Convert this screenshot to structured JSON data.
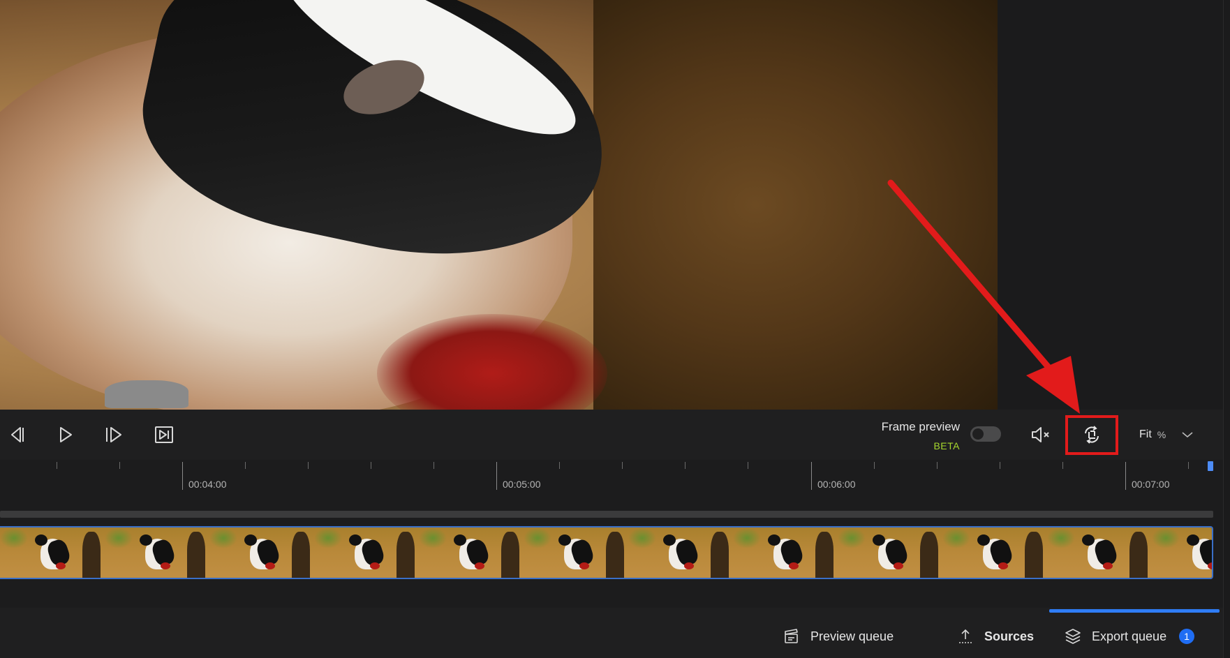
{
  "viewer": {
    "frame_description_icon": "video-frame"
  },
  "controls": {
    "frame_preview_label": "Frame preview",
    "frame_preview_badge": "BETA",
    "frame_preview_enabled": false,
    "zoom_value": "Fit",
    "zoom_unit": "%",
    "icons": {
      "prev_frame": "step-back-icon",
      "play": "play-icon",
      "next_frame": "step-forward-icon",
      "to_end": "skip-to-end-icon",
      "mute": "mute-icon",
      "crop": "crop-icon",
      "dropdown": "chevron-down-icon"
    }
  },
  "timeline": {
    "tick_labels": [
      "00:04:00",
      "00:05:00",
      "00:06:00",
      "00:07:00"
    ],
    "thumbnail_count": 12
  },
  "bottom_bar": {
    "tabs": [
      {
        "label": "Preview queue",
        "icon": "clapperboard-icon"
      },
      {
        "label": "Sources",
        "icon": "upload-icon"
      },
      {
        "label": "Export queue",
        "icon": "layers-icon",
        "badge": "1"
      }
    ],
    "active_tab": "Export queue"
  },
  "colors": {
    "accent": "#2f7df6",
    "beta": "#a6d62e",
    "annotation": "#e21b1b",
    "playhead": "#4d8cf5"
  }
}
